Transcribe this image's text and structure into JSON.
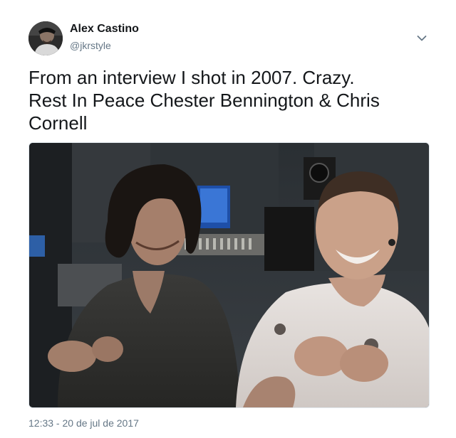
{
  "author": {
    "name": "Alex Castino",
    "handle": "@jkrstyle"
  },
  "tweet": {
    "lines": [
      "From an interview I shot in 2007.  Crazy.",
      "Rest In Peace Chester Bennington & Chris",
      "Cornell"
    ],
    "timestamp": "12:33 - 20 de jul de 2017"
  },
  "icons": {
    "caret": "chevron-down-icon"
  },
  "colors": {
    "text": "#14171a",
    "secondary": "#657786"
  }
}
